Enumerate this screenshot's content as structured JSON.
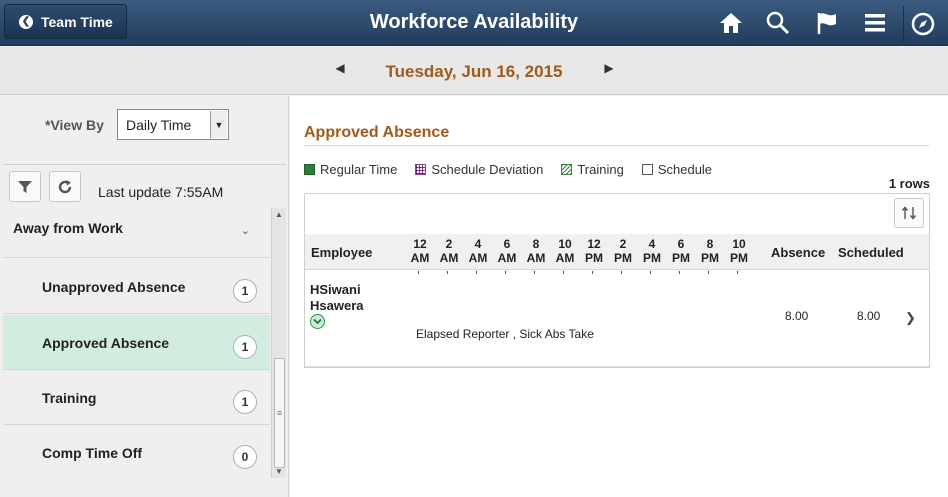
{
  "header": {
    "back_label": "Team Time",
    "title": "Workforce Availability",
    "icons": [
      "home-icon",
      "search-icon",
      "flag-icon",
      "menu-icon",
      "compass-icon"
    ]
  },
  "datebar": {
    "date": "Tuesday, Jun 16, 2015"
  },
  "left": {
    "view_by_label": "*View By",
    "view_by_value": "Daily Time",
    "last_update": "Last update 7:55AM",
    "group_label": "Away from Work",
    "items": [
      {
        "label": "Unapproved Absence",
        "count": "1"
      },
      {
        "label": "Approved Absence",
        "count": "1"
      },
      {
        "label": "Training",
        "count": "1"
      },
      {
        "label": "Comp Time Off",
        "count": "0"
      }
    ],
    "selected_item": "Approved Absence"
  },
  "main": {
    "section_title": "Approved Absence",
    "legend": [
      {
        "label": "Regular Time",
        "color": "#2e7d3a"
      },
      {
        "label": "Schedule Deviation",
        "color": "#8b3f8f"
      },
      {
        "label": "Training",
        "color": "#3a7f3a"
      },
      {
        "label": "Schedule",
        "color": "#ffffff"
      }
    ],
    "rows_count": "1 rows",
    "columns": {
      "employee": "Employee",
      "absence": "Absence",
      "scheduled": "Scheduled"
    },
    "hours": [
      {
        "num": "12",
        "ap": "AM"
      },
      {
        "num": "2",
        "ap": "AM"
      },
      {
        "num": "4",
        "ap": "AM"
      },
      {
        "num": "6",
        "ap": "AM"
      },
      {
        "num": "8",
        "ap": "AM"
      },
      {
        "num": "10",
        "ap": "AM"
      },
      {
        "num": "12",
        "ap": "PM"
      },
      {
        "num": "2",
        "ap": "PM"
      },
      {
        "num": "4",
        "ap": "PM"
      },
      {
        "num": "6",
        "ap": "PM"
      },
      {
        "num": "8",
        "ap": "PM"
      },
      {
        "num": "10",
        "ap": "PM"
      }
    ],
    "row": {
      "employee_first": "HSiwani",
      "employee_last": "Hsawera",
      "detail": "Elapsed Reporter , Sick Abs Take",
      "absence": "8.00",
      "scheduled": "8.00"
    }
  }
}
